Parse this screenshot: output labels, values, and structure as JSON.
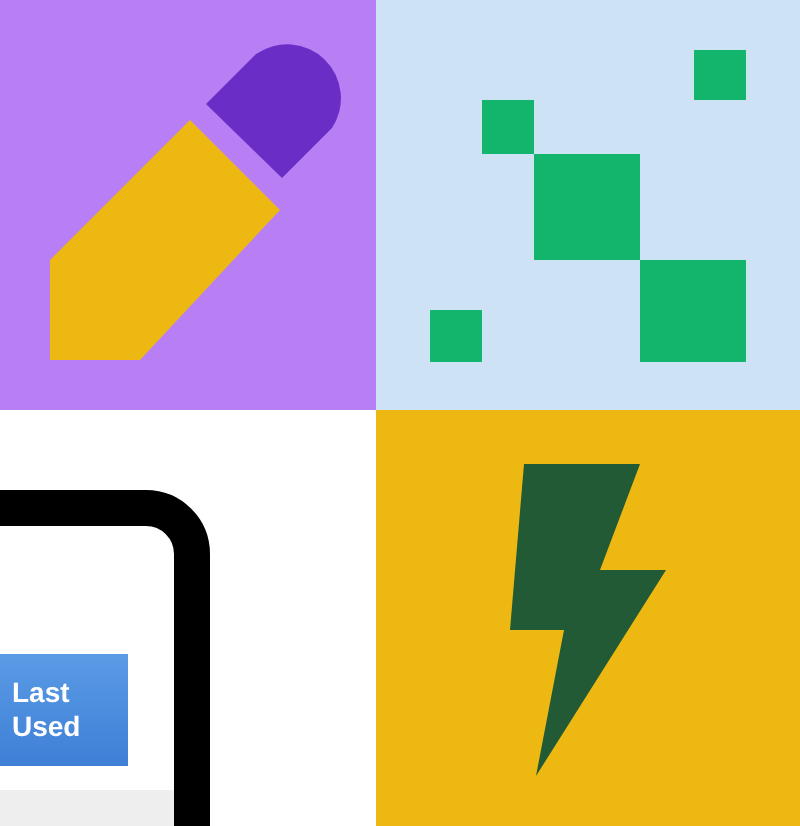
{
  "last_used_button": {
    "label": "Last Used"
  }
}
